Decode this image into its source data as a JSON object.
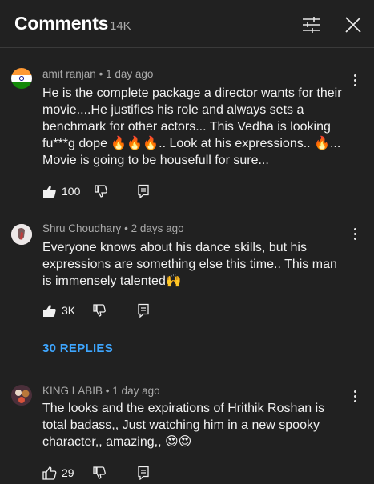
{
  "header": {
    "title": "Comments",
    "count": "14K"
  },
  "comments": [
    {
      "author": "amit ranjan",
      "time": "1 day ago",
      "text": "He is the complete package a director wants for their movie....He justifies his role and always sets a benchmark for other actors... This Vedha is looking fu***g dope 🔥🔥🔥.. Look at his expressions.. 🔥...\nMovie is going to be housefull for sure...",
      "likes": "100"
    },
    {
      "author": "Shru Choudhary",
      "time": "2 days ago",
      "text": "Everyone knows about his dance skills, but his expressions are something else this time.. This man is immensely talented🙌",
      "likes": "3K",
      "replies_label": "30 REPLIES"
    },
    {
      "author": "KING LABIB",
      "time": "1 day ago",
      "text": "The looks and the expirations of Hrithik Roshan is total badass,, Just watching him in a new spooky character,, amazing,, 😍😍",
      "likes": "29"
    }
  ],
  "meta_separator": "•",
  "icons": {
    "filter": "sliders-icon",
    "close": "close-icon",
    "like_active": "thumbs-up-filled-icon",
    "like": "thumbs-up-outline-icon",
    "dislike": "thumbs-down-outline-icon",
    "reply": "reply-icon",
    "more": "more-vertical-icon"
  },
  "colors": {
    "background": "#212121",
    "link": "#3ea6ff",
    "secondary_text": "#aaaaaa"
  }
}
